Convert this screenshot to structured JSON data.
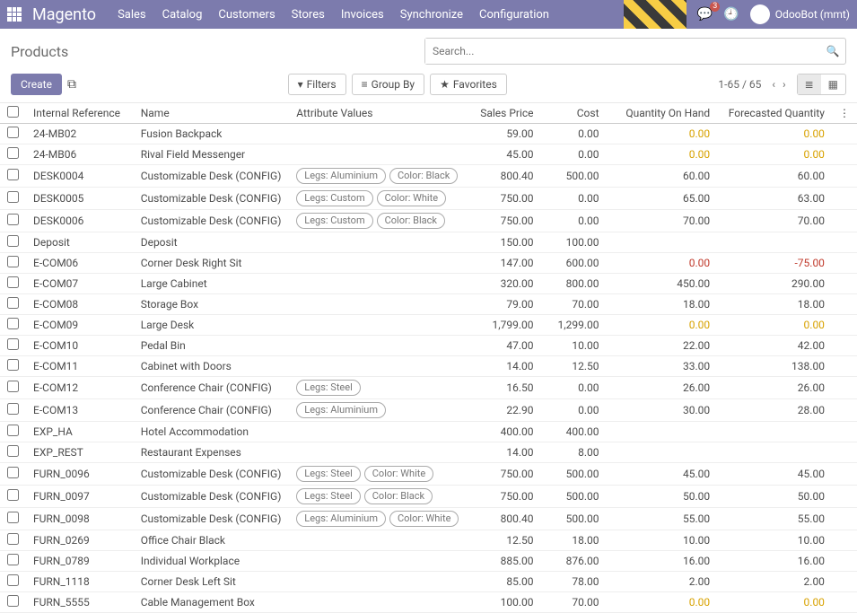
{
  "topbar": {
    "brand": "Magento",
    "menu": [
      "Sales",
      "Catalog",
      "Customers",
      "Stores",
      "Invoices",
      "Synchronize",
      "Configuration"
    ],
    "msg_badge": "3",
    "user": "OdooBot (mmt)"
  },
  "header": {
    "title": "Products",
    "search_placeholder": "Search...",
    "create": "Create",
    "filters": "Filters",
    "groupby": "Group By",
    "favorites": "Favorites",
    "pager": "1-65 / 65"
  },
  "columns": {
    "ref": "Internal Reference",
    "name": "Name",
    "attr": "Attribute Values",
    "sales": "Sales Price",
    "cost": "Cost",
    "qty": "Quantity On Hand",
    "fore": "Forecasted Quantity"
  },
  "rows": [
    {
      "ref": "24-MB02",
      "name": "Fusion Backpack",
      "attr": [],
      "sales": "59.00",
      "cost": "0.00",
      "qty": "0.00",
      "fore": "0.00",
      "qcls": "yellow",
      "fcls": "yellow"
    },
    {
      "ref": "24-MB06",
      "name": "Rival Field Messenger",
      "attr": [],
      "sales": "45.00",
      "cost": "0.00",
      "qty": "0.00",
      "fore": "0.00",
      "qcls": "yellow",
      "fcls": "yellow"
    },
    {
      "ref": "DESK0004",
      "name": "Customizable Desk (CONFIG)",
      "attr": [
        "Legs: Aluminium",
        "Color: Black"
      ],
      "sales": "800.40",
      "cost": "500.00",
      "qty": "60.00",
      "fore": "60.00"
    },
    {
      "ref": "DESK0005",
      "name": "Customizable Desk (CONFIG)",
      "attr": [
        "Legs: Custom",
        "Color: White"
      ],
      "sales": "750.00",
      "cost": "0.00",
      "qty": "65.00",
      "fore": "63.00"
    },
    {
      "ref": "DESK0006",
      "name": "Customizable Desk (CONFIG)",
      "attr": [
        "Legs: Custom",
        "Color: Black"
      ],
      "sales": "750.00",
      "cost": "0.00",
      "qty": "70.00",
      "fore": "70.00"
    },
    {
      "ref": "Deposit",
      "name": "Deposit",
      "attr": [],
      "sales": "150.00",
      "cost": "100.00",
      "qty": "",
      "fore": ""
    },
    {
      "ref": "E-COM06",
      "name": "Corner Desk Right Sit",
      "attr": [],
      "sales": "147.00",
      "cost": "600.00",
      "qty": "0.00",
      "fore": "-75.00",
      "qcls": "red",
      "fcls": "red"
    },
    {
      "ref": "E-COM07",
      "name": "Large Cabinet",
      "attr": [],
      "sales": "320.00",
      "cost": "800.00",
      "qty": "450.00",
      "fore": "290.00"
    },
    {
      "ref": "E-COM08",
      "name": "Storage Box",
      "attr": [],
      "sales": "79.00",
      "cost": "70.00",
      "qty": "18.00",
      "fore": "18.00"
    },
    {
      "ref": "E-COM09",
      "name": "Large Desk",
      "attr": [],
      "sales": "1,799.00",
      "cost": "1,299.00",
      "qty": "0.00",
      "fore": "0.00",
      "qcls": "yellow",
      "fcls": "yellow"
    },
    {
      "ref": "E-COM10",
      "name": "Pedal Bin",
      "attr": [],
      "sales": "47.00",
      "cost": "10.00",
      "qty": "22.00",
      "fore": "42.00"
    },
    {
      "ref": "E-COM11",
      "name": "Cabinet with Doors",
      "attr": [],
      "sales": "14.00",
      "cost": "12.50",
      "qty": "33.00",
      "fore": "138.00"
    },
    {
      "ref": "E-COM12",
      "name": "Conference Chair (CONFIG)",
      "attr": [
        "Legs: Steel"
      ],
      "sales": "16.50",
      "cost": "0.00",
      "qty": "26.00",
      "fore": "26.00"
    },
    {
      "ref": "E-COM13",
      "name": "Conference Chair (CONFIG)",
      "attr": [
        "Legs: Aluminium"
      ],
      "sales": "22.90",
      "cost": "0.00",
      "qty": "30.00",
      "fore": "28.00"
    },
    {
      "ref": "EXP_HA",
      "name": "Hotel Accommodation",
      "attr": [],
      "sales": "400.00",
      "cost": "400.00",
      "qty": "",
      "fore": ""
    },
    {
      "ref": "EXP_REST",
      "name": "Restaurant Expenses",
      "attr": [],
      "sales": "14.00",
      "cost": "8.00",
      "qty": "",
      "fore": ""
    },
    {
      "ref": "FURN_0096",
      "name": "Customizable Desk (CONFIG)",
      "attr": [
        "Legs: Steel",
        "Color: White"
      ],
      "sales": "750.00",
      "cost": "500.00",
      "qty": "45.00",
      "fore": "45.00"
    },
    {
      "ref": "FURN_0097",
      "name": "Customizable Desk (CONFIG)",
      "attr": [
        "Legs: Steel",
        "Color: Black"
      ],
      "sales": "750.00",
      "cost": "500.00",
      "qty": "50.00",
      "fore": "50.00"
    },
    {
      "ref": "FURN_0098",
      "name": "Customizable Desk (CONFIG)",
      "attr": [
        "Legs: Aluminium",
        "Color: White"
      ],
      "sales": "800.40",
      "cost": "500.00",
      "qty": "55.00",
      "fore": "55.00"
    },
    {
      "ref": "FURN_0269",
      "name": "Office Chair Black",
      "attr": [],
      "sales": "12.50",
      "cost": "18.00",
      "qty": "10.00",
      "fore": "10.00"
    },
    {
      "ref": "FURN_0789",
      "name": "Individual Workplace",
      "attr": [],
      "sales": "885.00",
      "cost": "876.00",
      "qty": "16.00",
      "fore": "16.00"
    },
    {
      "ref": "FURN_1118",
      "name": "Corner Desk Left Sit",
      "attr": [],
      "sales": "85.00",
      "cost": "78.00",
      "qty": "2.00",
      "fore": "2.00"
    },
    {
      "ref": "FURN_5555",
      "name": "Cable Management Box",
      "attr": [],
      "sales": "100.00",
      "cost": "70.00",
      "qty": "0.00",
      "fore": "0.00",
      "qcls": "yellow",
      "fcls": "yellow"
    }
  ]
}
